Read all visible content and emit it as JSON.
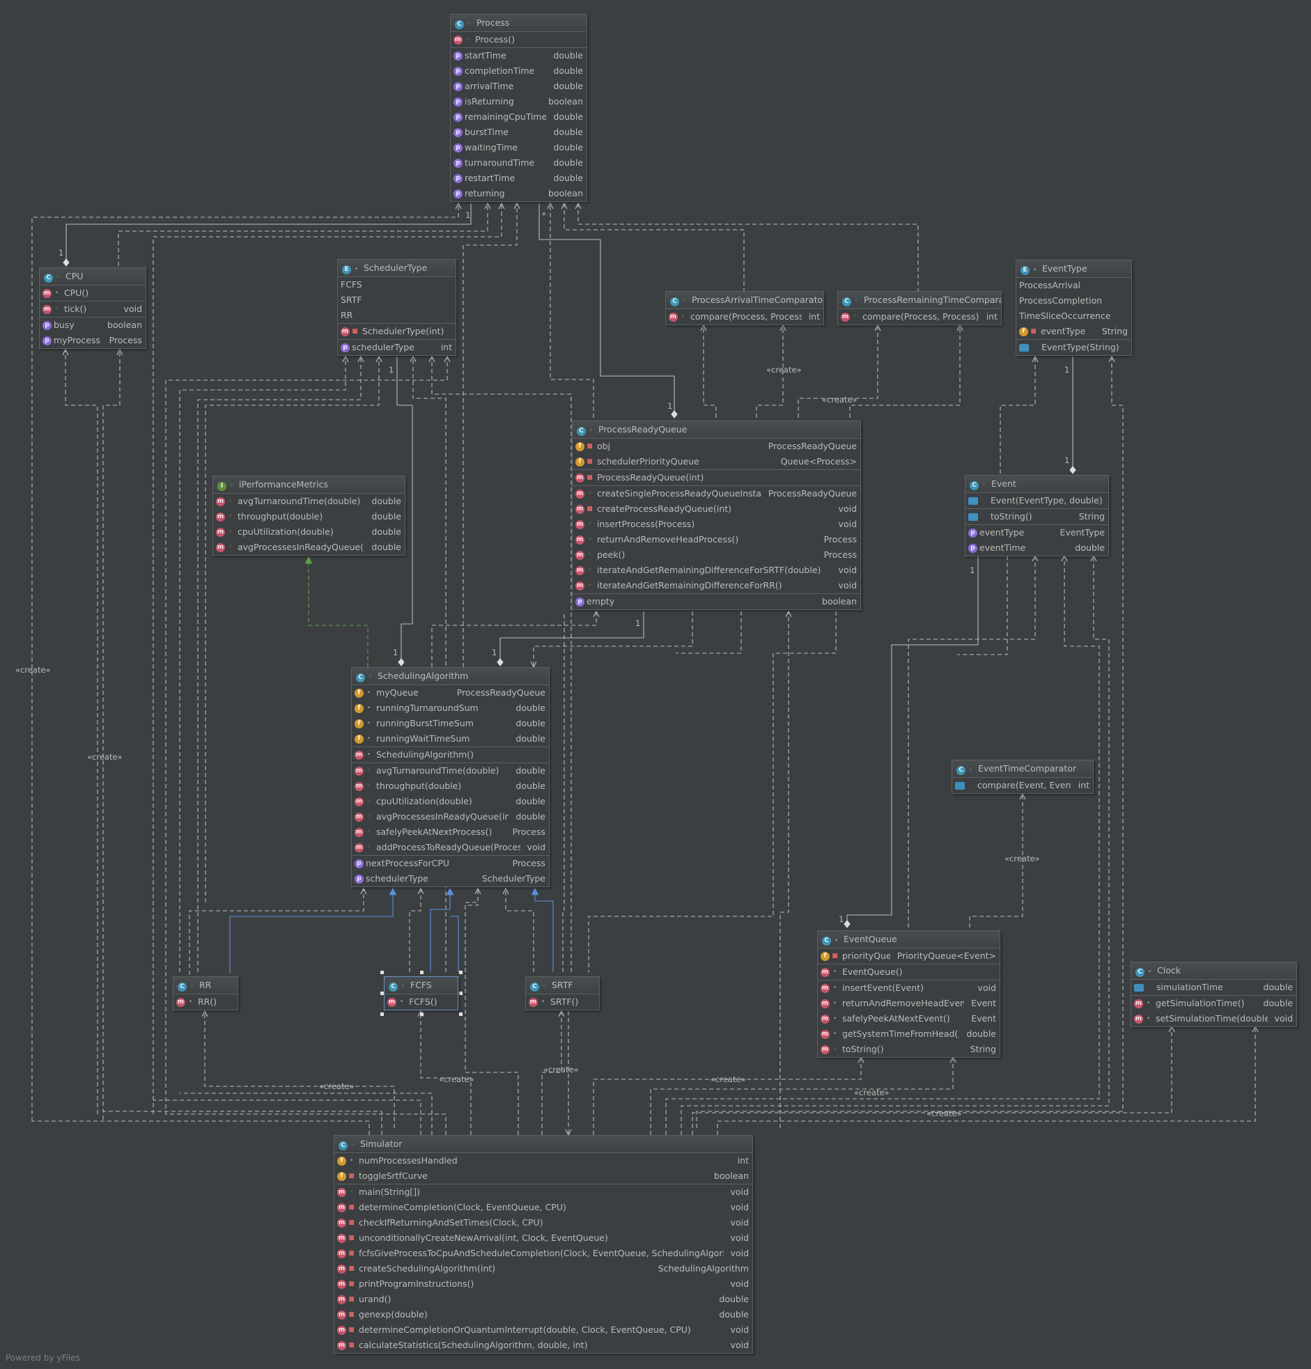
{
  "footer": "Powered by yFiles",
  "edge_labels": {
    "create": "«create»",
    "one": "1",
    "star": "*"
  },
  "nodes": {
    "process": {
      "title": "Process",
      "constructors": [
        {
          "name": "Process()",
          "type": ""
        }
      ],
      "properties": [
        {
          "name": "startTime",
          "type": "double"
        },
        {
          "name": "completionTime",
          "type": "double"
        },
        {
          "name": "arrivalTime",
          "type": "double"
        },
        {
          "name": "isReturning",
          "type": "boolean"
        },
        {
          "name": "remainingCpuTime",
          "type": "double"
        },
        {
          "name": "burstTime",
          "type": "double"
        },
        {
          "name": "waitingTime",
          "type": "double"
        },
        {
          "name": "turnaroundTime",
          "type": "double"
        },
        {
          "name": "restartTime",
          "type": "double"
        },
        {
          "name": "returning",
          "type": "boolean"
        }
      ]
    },
    "cpu": {
      "title": "CPU",
      "constructors": [
        {
          "name": "CPU()",
          "type": ""
        }
      ],
      "methods": [
        {
          "name": "tick()",
          "type": "void"
        }
      ],
      "properties": [
        {
          "name": "busy",
          "type": "boolean"
        },
        {
          "name": "myProcess",
          "type": "Process"
        }
      ]
    },
    "scheduler_type": {
      "title": "SchedulerType",
      "constants": [
        "FCFS",
        "SRTF",
        "RR"
      ],
      "constructors": [
        {
          "name": "SchedulerType(int)",
          "type": ""
        }
      ],
      "properties": [
        {
          "name": "schedulerType",
          "type": "int"
        }
      ]
    },
    "arrival_comparator": {
      "title": "ProcessArrivalTimeComparator",
      "methods": [
        {
          "name": "compare(Process, Process)",
          "type": "int"
        }
      ]
    },
    "remaining_comparator": {
      "title": "ProcessRemainingTimeComparator",
      "methods": [
        {
          "name": "compare(Process, Process)",
          "type": "int"
        }
      ]
    },
    "event_type": {
      "title": "EventType",
      "constants": [
        "ProcessArrival",
        "ProcessCompletion",
        "TimeSliceOccurrence"
      ],
      "fields": [
        {
          "name": "eventType",
          "type": "String"
        }
      ],
      "constructors": [
        {
          "name": "EventType(String)",
          "type": ""
        }
      ]
    },
    "ready_queue": {
      "title": "ProcessReadyQueue",
      "fields": [
        {
          "name": "obj",
          "type": "ProcessReadyQueue"
        },
        {
          "name": "schedulerPriorityQueue",
          "type": "Queue<Process>"
        }
      ],
      "constructors": [
        {
          "name": "ProcessReadyQueue(int)",
          "type": ""
        }
      ],
      "methods": [
        {
          "name": "createSingleProcessReadyQueueInstance(int)",
          "type": "ProcessReadyQueue",
          "vis": "pub"
        },
        {
          "name": "createProcessReadyQueue(int)",
          "type": "void",
          "vis": "priv"
        },
        {
          "name": "insertProcess(Process)",
          "type": "void",
          "vis": "pub"
        },
        {
          "name": "returnAndRemoveHeadProcess()",
          "type": "Process",
          "vis": "pub"
        },
        {
          "name": "peek()",
          "type": "Process",
          "vis": "pub"
        },
        {
          "name": "iterateAndGetRemainingDifferenceForSRTF(double)",
          "type": "void",
          "vis": "pub"
        },
        {
          "name": "iterateAndGetRemainingDifferenceForRR()",
          "type": "void",
          "vis": "pub"
        }
      ],
      "properties": [
        {
          "name": "empty",
          "type": "boolean"
        }
      ]
    },
    "perf_metrics": {
      "title": "iPerformanceMetrics",
      "methods": [
        {
          "name": "avgTurnaroundTime(double)",
          "type": "double"
        },
        {
          "name": "throughput(double)",
          "type": "double"
        },
        {
          "name": "cpuUtilization(double)",
          "type": "double"
        },
        {
          "name": "avgProcessesInReadyQueue(int)",
          "type": "double"
        }
      ]
    },
    "event": {
      "title": "Event",
      "constructors": [
        {
          "name": "Event(EventType, double)",
          "type": ""
        }
      ],
      "methods": [
        {
          "name": "toString()",
          "type": "String"
        }
      ],
      "properties": [
        {
          "name": "eventType",
          "type": "EventType"
        },
        {
          "name": "eventTime",
          "type": "double"
        }
      ]
    },
    "scheduling_algorithm": {
      "title": "SchedulingAlgorithm",
      "fields": [
        {
          "name": "myQueue",
          "type": "ProcessReadyQueue"
        },
        {
          "name": "runningTurnaroundSum",
          "type": "double"
        },
        {
          "name": "runningBurstTimeSum",
          "type": "double"
        },
        {
          "name": "runningWaitTimeSum",
          "type": "double"
        }
      ],
      "constructors": [
        {
          "name": "SchedulingAlgorithm()",
          "type": ""
        }
      ],
      "methods": [
        {
          "name": "avgTurnaroundTime(double)",
          "type": "double"
        },
        {
          "name": "throughput(double)",
          "type": "double"
        },
        {
          "name": "cpuUtilization(double)",
          "type": "double"
        },
        {
          "name": "avgProcessesInReadyQueue(int)",
          "type": "double"
        },
        {
          "name": "safelyPeekAtNextProcess()",
          "type": "Process"
        },
        {
          "name": "addProcessToReadyQueue(Process)",
          "type": "void"
        }
      ],
      "properties": [
        {
          "name": "nextProcessForCPU",
          "type": "Process"
        },
        {
          "name": "schedulerType",
          "type": "SchedulerType"
        }
      ]
    },
    "event_time_comparator": {
      "title": "EventTimeComparator",
      "methods": [
        {
          "name": "compare(Event, Event)",
          "type": "int"
        }
      ]
    },
    "rr": {
      "title": "RR",
      "constructors": [
        {
          "name": "RR()",
          "type": ""
        }
      ]
    },
    "fcfs": {
      "title": "FCFS",
      "constructors": [
        {
          "name": "FCFS()",
          "type": ""
        }
      ]
    },
    "srtf": {
      "title": "SRTF",
      "constructors": [
        {
          "name": "SRTF()",
          "type": ""
        }
      ]
    },
    "event_queue": {
      "title": "EventQueue",
      "fields": [
        {
          "name": "priorityQueue",
          "type": "PriorityQueue<Event>"
        }
      ],
      "constructors": [
        {
          "name": "EventQueue()",
          "type": ""
        }
      ],
      "methods": [
        {
          "name": "insertEvent(Event)",
          "type": "void"
        },
        {
          "name": "returnAndRemoveHeadEvent()",
          "type": "Event"
        },
        {
          "name": "safelyPeekAtNextEvent()",
          "type": "Event"
        },
        {
          "name": "getSystemTimeFromHead()",
          "type": "double"
        },
        {
          "name": "toString()",
          "type": "String"
        }
      ]
    },
    "clock": {
      "title": "Clock",
      "fields": [
        {
          "name": "simulationTime",
          "type": "double"
        }
      ],
      "methods": [
        {
          "name": "getSimulationTime()",
          "type": "double"
        },
        {
          "name": "setSimulationTime(double)",
          "type": "void"
        }
      ]
    },
    "simulator": {
      "title": "Simulator",
      "fields": [
        {
          "name": "numProcessesHandled",
          "type": "int"
        },
        {
          "name": "toggleSrtfCurve",
          "type": "boolean"
        }
      ],
      "methods": [
        {
          "name": "main(String[])",
          "type": "void",
          "vis": "pub"
        },
        {
          "name": "determineCompletion(Clock, EventQueue, CPU)",
          "type": "void",
          "vis": "priv"
        },
        {
          "name": "checkIfReturningAndSetTimes(Clock, CPU)",
          "type": "void",
          "vis": "priv"
        },
        {
          "name": "unconditionallyCreateNewArrival(int, Clock, EventQueue)",
          "type": "void",
          "vis": "priv"
        },
        {
          "name": "fcfsGiveProcessToCpuAndScheduleCompletion(Clock, EventQueue, SchedulingAlgorithm, CPU)",
          "type": "void",
          "vis": "priv"
        },
        {
          "name": "createSchedulingAlgorithm(int)",
          "type": "SchedulingAlgorithm",
          "vis": "priv"
        },
        {
          "name": "printProgramInstructions()",
          "type": "void",
          "vis": "priv"
        },
        {
          "name": "urand()",
          "type": "double",
          "vis": "priv"
        },
        {
          "name": "genexp(double)",
          "type": "double",
          "vis": "priv"
        },
        {
          "name": "determineCompletionOrQuantumInterrupt(double, Clock, EventQueue, CPU)",
          "type": "void",
          "vis": "priv"
        },
        {
          "name": "calculateStatistics(SchedulingAlgorithm, double, int)",
          "type": "void",
          "vis": "priv"
        }
      ]
    }
  }
}
